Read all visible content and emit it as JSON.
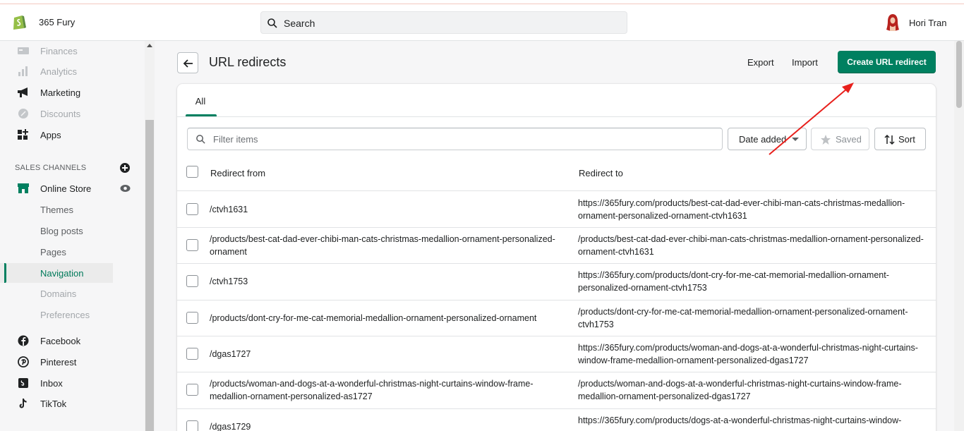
{
  "topbar": {
    "store_name": "365 Fury",
    "search_placeholder": "Search",
    "user_name": "Hori Tran"
  },
  "sidebar": {
    "items_top": [
      {
        "label": "Finances",
        "icon": "bank-icon",
        "dim": true
      },
      {
        "label": "Analytics",
        "icon": "bar-chart-icon",
        "dim": true
      },
      {
        "label": "Marketing",
        "icon": "megaphone-icon",
        "dim": false
      },
      {
        "label": "Discounts",
        "icon": "discount-icon",
        "dim": true
      },
      {
        "label": "Apps",
        "icon": "apps-icon",
        "dim": false
      }
    ],
    "sales_channels_label": "SALES CHANNELS",
    "online_store": "Online Store",
    "sub_items": [
      {
        "label": "Themes"
      },
      {
        "label": "Blog posts"
      },
      {
        "label": "Pages"
      },
      {
        "label": "Navigation",
        "active": true
      },
      {
        "label": "Domains",
        "dim": true
      },
      {
        "label": "Preferences",
        "dim": true
      }
    ],
    "channels": [
      {
        "label": "Facebook",
        "icon": "facebook-icon"
      },
      {
        "label": "Pinterest",
        "icon": "pinterest-icon"
      },
      {
        "label": "Inbox",
        "icon": "inbox-icon"
      },
      {
        "label": "TikTok",
        "icon": "tiktok-icon"
      }
    ]
  },
  "page": {
    "title": "URL redirects",
    "export_label": "Export",
    "import_label": "Import",
    "create_label": "Create URL redirect"
  },
  "card": {
    "tab_all": "All",
    "filter_placeholder": "Filter items",
    "date_added": "Date added",
    "saved": "Saved",
    "sort": "Sort",
    "col_from": "Redirect from",
    "col_to": "Redirect to",
    "rows": [
      {
        "from": "/ctvh1631",
        "to": "https://365fury.com/products/best-cat-dad-ever-chibi-man-cats-christmas-medallion-ornament-personalized-ornament-ctvh1631"
      },
      {
        "from": "/products/best-cat-dad-ever-chibi-man-cats-christmas-medallion-ornament-personalized-ornament",
        "to": "/products/best-cat-dad-ever-chibi-man-cats-christmas-medallion-ornament-personalized-ornament-ctvh1631"
      },
      {
        "from": "/ctvh1753",
        "to": "https://365fury.com/products/dont-cry-for-me-cat-memorial-medallion-ornament-personalized-ornament-ctvh1753"
      },
      {
        "from": "/products/dont-cry-for-me-cat-memorial-medallion-ornament-personalized-ornament",
        "to": "/products/dont-cry-for-me-cat-memorial-medallion-ornament-personalized-ornament-ctvh1753"
      },
      {
        "from": "/dgas1727",
        "to": "https://365fury.com/products/woman-and-dogs-at-a-wonderful-christmas-night-curtains-window-frame-medallion-ornament-personalized-dgas1727"
      },
      {
        "from": "/products/woman-and-dogs-at-a-wonderful-christmas-night-curtains-window-frame-medallion-ornament-personalized-as1727",
        "to": "/products/woman-and-dogs-at-a-wonderful-christmas-night-curtains-window-frame-medallion-ornament-personalized-dgas1727"
      },
      {
        "from": "/dgas1729",
        "to": "https://365fury.com/products/dogs-at-a-wonderful-christmas-night-curtains-window-"
      }
    ]
  },
  "colors": {
    "primary": "#008060",
    "annotation_arrow": "#e8201c"
  }
}
